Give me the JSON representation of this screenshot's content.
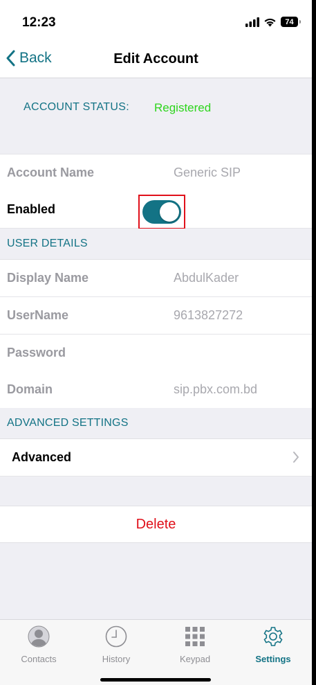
{
  "status_bar": {
    "time": "12:23",
    "battery": "74"
  },
  "nav": {
    "back_label": "Back",
    "title": "Edit Account"
  },
  "account_status": {
    "label": "ACCOUNT STATUS:",
    "value": "Registered"
  },
  "account": {
    "name_label": "Account Name",
    "name_value": "Generic SIP",
    "enabled_label": "Enabled",
    "enabled": true
  },
  "user_details": {
    "header": "USER DETAILS",
    "display_name_label": "Display Name",
    "display_name_value": "AbdulKader",
    "username_label": "UserName",
    "username_value": "9613827272",
    "password_label": "Password",
    "password_value": "",
    "domain_label": "Domain",
    "domain_value": "sip.pbx.com.bd"
  },
  "advanced": {
    "header": "ADVANCED SETTINGS",
    "item_label": "Advanced"
  },
  "delete_label": "Delete",
  "tabs": [
    {
      "label": "Contacts",
      "icon": "contacts-icon"
    },
    {
      "label": "History",
      "icon": "clock-icon"
    },
    {
      "label": "Keypad",
      "icon": "keypad-icon"
    },
    {
      "label": "Settings",
      "icon": "gear-icon"
    }
  ],
  "colors": {
    "accent": "#137385",
    "registered": "#2ed51d",
    "delete": "#e0101a",
    "highlight": "#e0101a"
  }
}
